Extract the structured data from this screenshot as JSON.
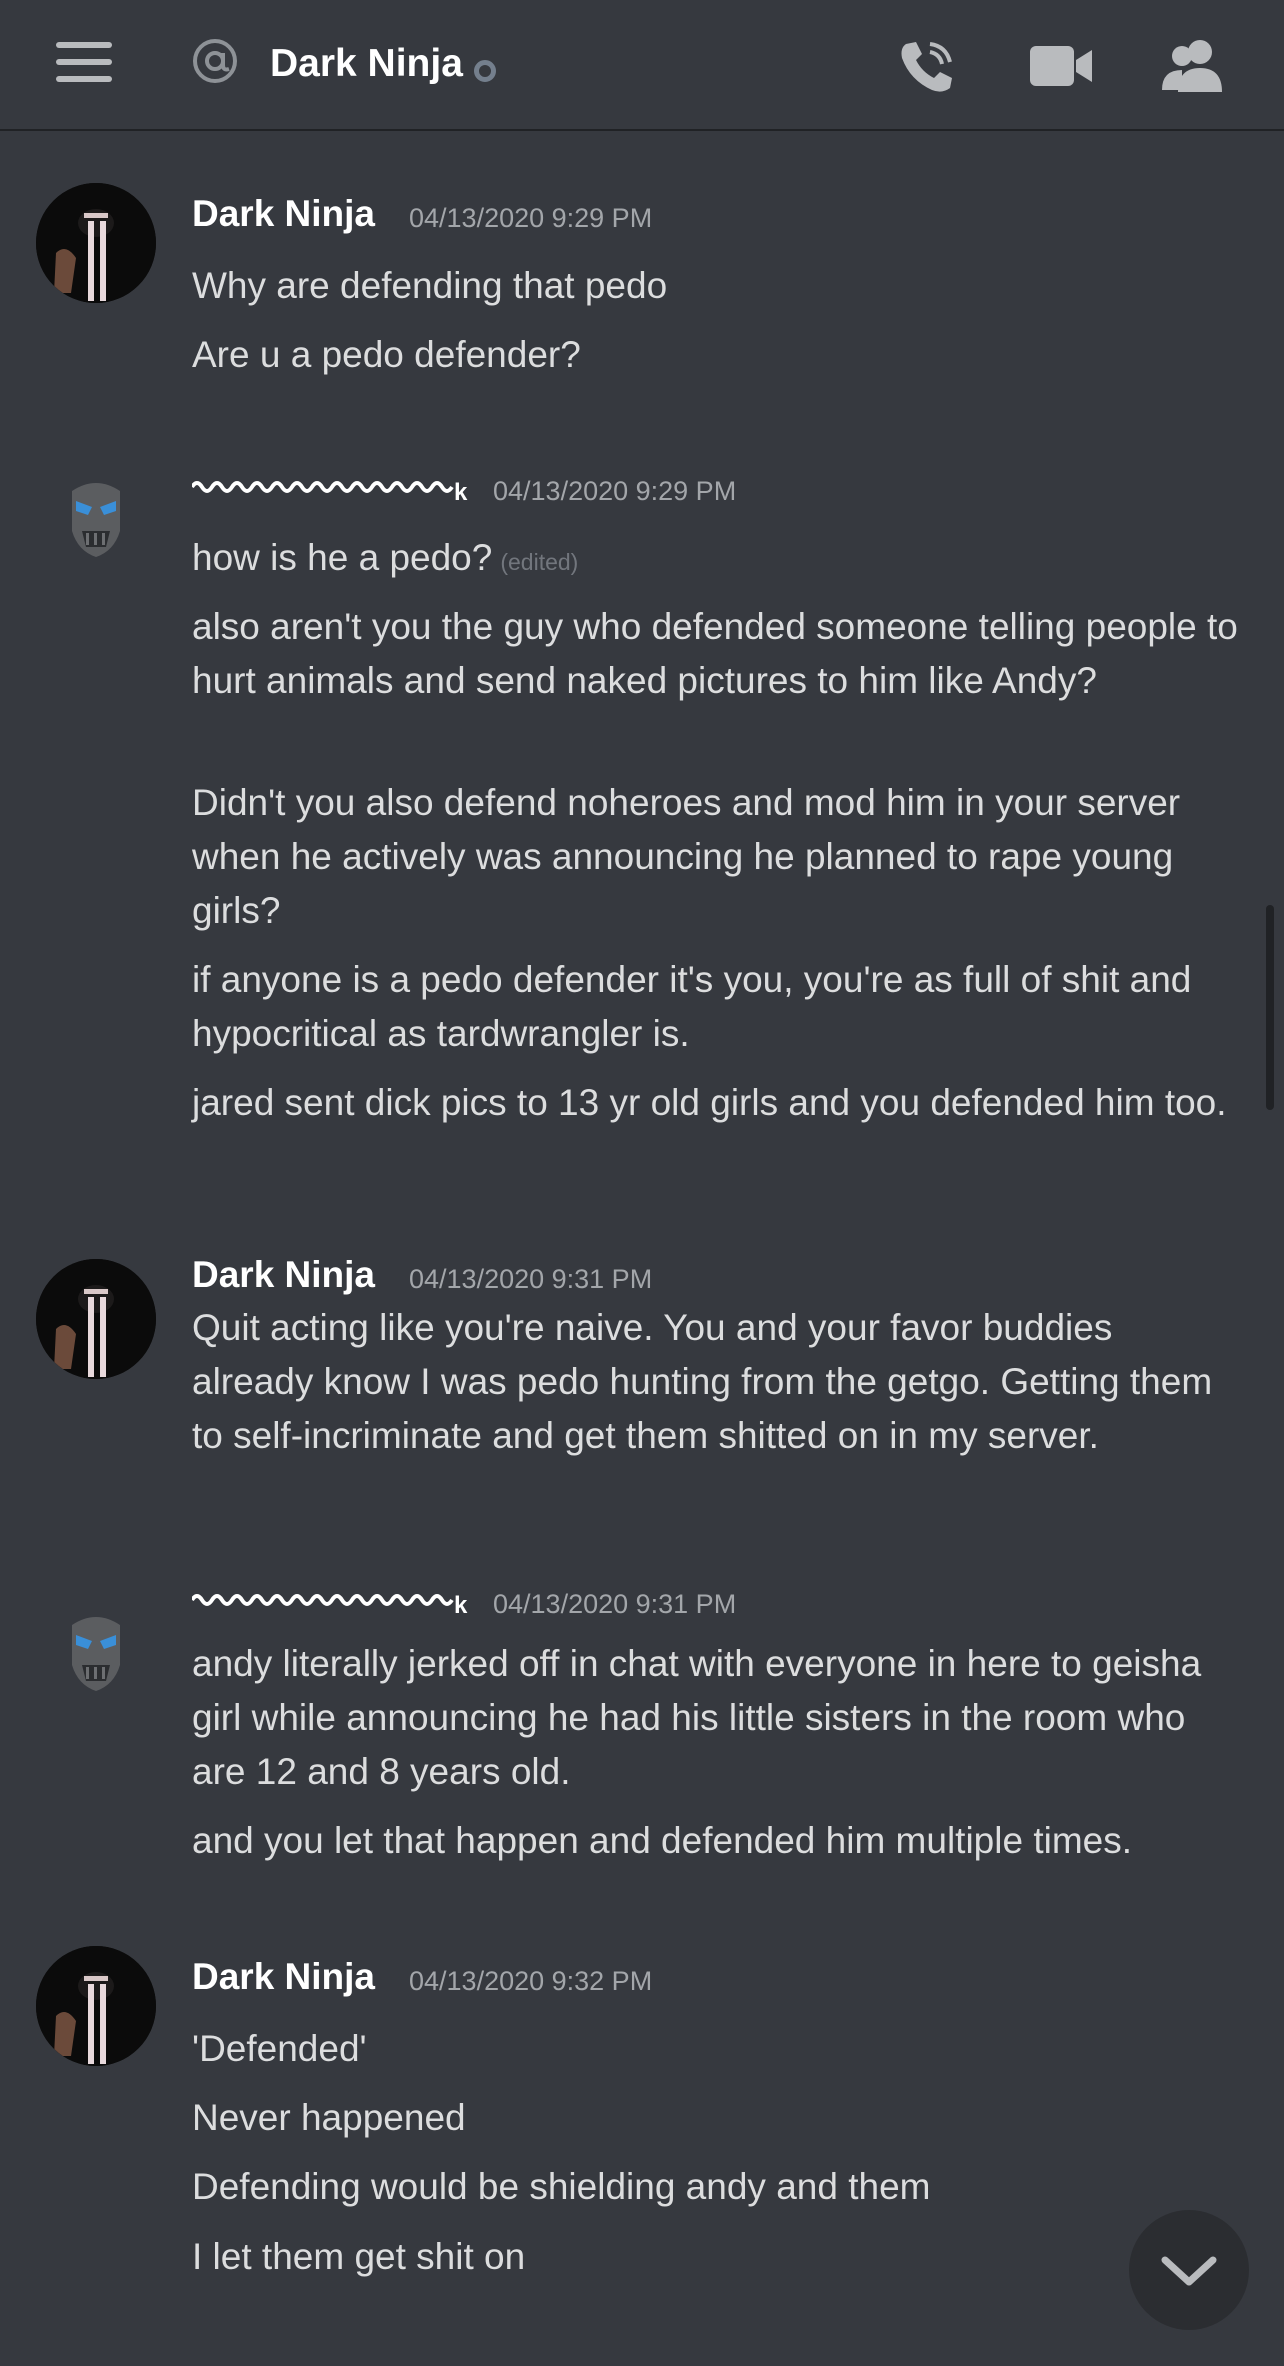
{
  "header": {
    "menu_icon": "hamburger-menu-icon",
    "mention_icon": "at-sign-icon",
    "channel_name": "Dark Ninja",
    "status": "offline",
    "actions": [
      "phone-call-icon",
      "video-camera-icon",
      "members-icon"
    ]
  },
  "messages": [
    {
      "author": "Dark Ninja",
      "timestamp": "04/13/2020 9:29 PM",
      "lines": [
        "Why are defending that pedo",
        "Are u a pedo defender?"
      ]
    },
    {
      "author": "k",
      "timestamp": "04/13/2020 9:29 PM",
      "lines": [
        "how is he a pedo?",
        "also aren't you the guy who defended someone telling people to hurt animals and send naked pictures to him like Andy?",
        "Didn't you also defend noheroes and mod him in your server when he actively was announcing he planned to rape young girls?",
        "if anyone is a pedo defender it's you, you're as full of shit and hypocritical as tardwrangler is.",
        "jared sent dick pics to 13 yr old girls and you defended him too."
      ],
      "edited_label": "(edited)"
    },
    {
      "author": "Dark Ninja",
      "timestamp": "04/13/2020 9:31 PM",
      "lines": [
        "Quit acting like you're naive. You and your favor buddies already know I was pedo hunting from the getgo. Getting them to self-incriminate and get them shitted on in my server."
      ]
    },
    {
      "author": "k",
      "timestamp": "04/13/2020 9:31 PM",
      "lines": [
        "andy literally jerked off in chat with everyone in here to geisha girl while announcing he had his little sisters in the room who are 12 and 8 years old.",
        "and you let that happen and defended him multiple times."
      ]
    },
    {
      "author": "Dark Ninja",
      "timestamp": "04/13/2020 9:32 PM",
      "lines": [
        "'Defended'",
        "Never happened",
        "Defending would be shielding andy and them",
        "I let them get shit on"
      ]
    }
  ],
  "jump_button_icon": "chevron-down-icon",
  "colors": {
    "background": "#36393f",
    "text": "#dcddde",
    "username": "#ffffff",
    "timestamp": "#a3a6aa"
  }
}
